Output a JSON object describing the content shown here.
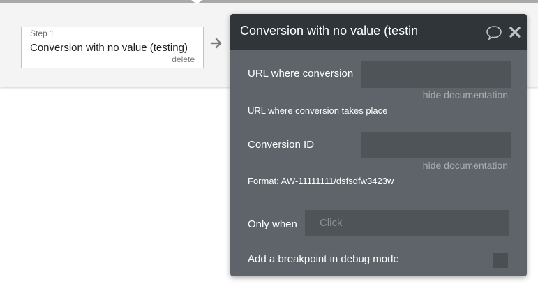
{
  "step": {
    "label": "Step 1",
    "title": "Conversion with no value (testing)",
    "delete_label": "delete"
  },
  "panel": {
    "title": "Conversion with no value (testin",
    "fields": [
      {
        "label": "URL where conversion",
        "value": "",
        "hide_doc_label": "hide documentation",
        "documentation": "URL where conversion takes place"
      },
      {
        "label": "Conversion ID",
        "value": "",
        "hide_doc_label": "hide documentation",
        "documentation": "Format: AW-11111111/dsfsdfw3423w"
      }
    ],
    "only_when": {
      "label": "Only when",
      "placeholder": "Click"
    },
    "breakpoint": {
      "label": "Add a breakpoint in debug mode",
      "checked": false
    }
  },
  "icons": {
    "arrow": "arrow-right-icon",
    "comment": "comment-icon",
    "close": "close-icon"
  },
  "colors": {
    "panel_bg": "#5e646a",
    "header_bg": "#2f3539",
    "input_bg": "#4f5458"
  }
}
